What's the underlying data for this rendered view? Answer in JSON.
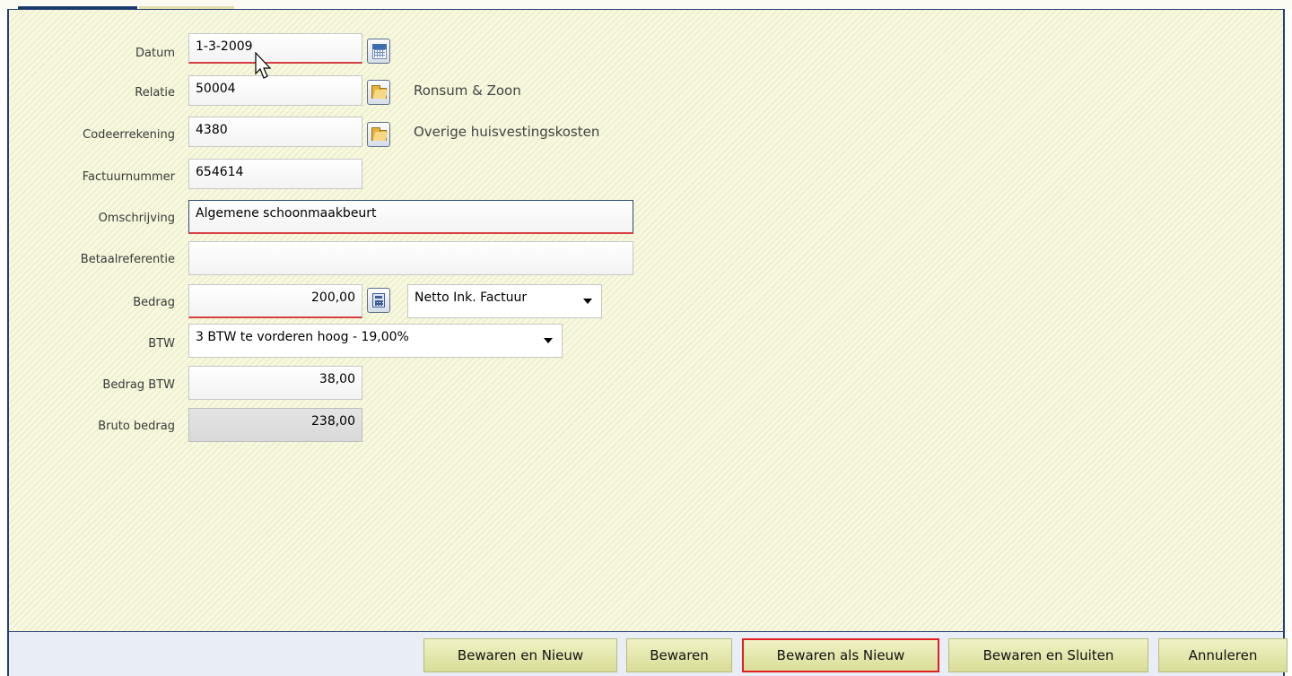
{
  "form": {
    "datum": {
      "label": "Datum",
      "value": "1-3-2009"
    },
    "relatie": {
      "label": "Relatie",
      "value": "50004",
      "description": "Ronsum & Zoon"
    },
    "codeerrekening": {
      "label": "Codeerrekening",
      "value": "4380",
      "description": "Overige huisvestingskosten"
    },
    "factuurnummer": {
      "label": "Factuurnummer",
      "value": "654614"
    },
    "omschrijving": {
      "label": "Omschrijving",
      "value": "Algemene schoonmaakbeurt"
    },
    "betaalreferentie": {
      "label": "Betaalreferentie",
      "value": ""
    },
    "bedrag": {
      "label": "Bedrag",
      "value": "200,00",
      "type_selected": "Netto Ink. Factuur"
    },
    "btw": {
      "label": "BTW",
      "selected": "3 BTW te vorderen hoog - 19,00%"
    },
    "bedrag_btw": {
      "label": "Bedrag BTW",
      "value": "38,00"
    },
    "bruto_bedrag": {
      "label": "Bruto bedrag",
      "value": "238,00"
    }
  },
  "icons": {
    "datum_picker": "calendar-icon",
    "relatie_lookup": "folder-open-icon",
    "codeerrekening_lookup": "folder-open-icon",
    "bedrag_calc": "calculator-icon"
  },
  "footer": {
    "buttons": [
      {
        "label": "Bewaren en Nieuw"
      },
      {
        "label": "Bewaren"
      },
      {
        "label": "Bewaren als Nieuw",
        "highlighted": true
      },
      {
        "label": "Bewaren en Sluiten"
      },
      {
        "label": "Annuleren"
      }
    ]
  },
  "colors": {
    "panel_bg": "#f7f8de",
    "button_bg": "#d9dd97",
    "highlight": "#e02020",
    "frame": "#243f73",
    "error_underline": "#d64040"
  }
}
